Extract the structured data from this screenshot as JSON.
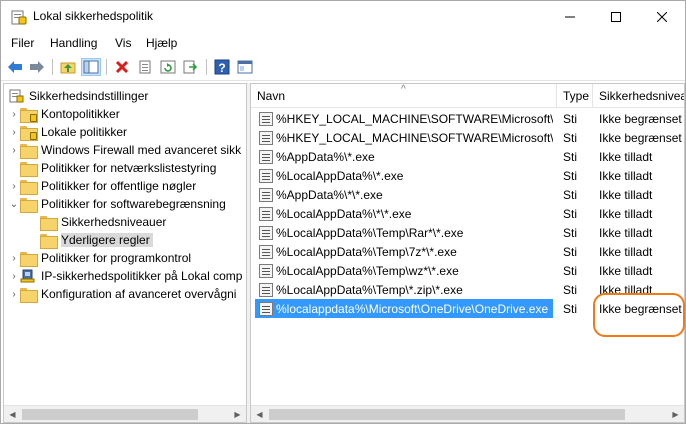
{
  "window": {
    "title": "Lokal sikkerhedspolitik",
    "icons": {
      "app": "security-policy-icon",
      "minimize": "minimize-icon",
      "maximize": "maximize-icon",
      "close": "close-icon"
    }
  },
  "menu": [
    "Filer",
    "Handling",
    "Vis",
    "Hjælp"
  ],
  "toolbar": [
    "back-icon",
    "forward-icon",
    "up-folder-icon",
    "show-hide-tree-icon",
    "delete-icon",
    "properties-icon",
    "refresh-icon",
    "export-list-icon",
    "help-icon",
    "console-tree-icon"
  ],
  "tree": {
    "root": "Sikkerhedsindstillinger",
    "items": [
      {
        "label": "Kontopolitikker",
        "expand": "›"
      },
      {
        "label": "Lokale politikker",
        "expand": "›"
      },
      {
        "label": "Windows Firewall med avanceret sikk",
        "expand": "›"
      },
      {
        "label": "Politikker for netværkslistestyring",
        "expand": ""
      },
      {
        "label": "Politikker for offentlige nøgler",
        "expand": "›"
      },
      {
        "label": "Politikker for softwarebegrænsning",
        "expand": "⌄"
      },
      {
        "label": "Sikkerhedsniveauer",
        "expand": ""
      },
      {
        "label": "Yderligere regler",
        "expand": ""
      },
      {
        "label": "Politikker for programkontrol",
        "expand": "›"
      },
      {
        "label": "IP-sikkerhedspolitikker på Lokal comp",
        "expand": "›"
      },
      {
        "label": "Konfiguration af avanceret overvågni",
        "expand": "›"
      }
    ]
  },
  "columns": {
    "name": "Navn",
    "type": "Type",
    "level": "Sikkerhedsnivea"
  },
  "rows": [
    {
      "name": "%HKEY_LOCAL_MACHINE\\SOFTWARE\\Microsoft\\...",
      "type": "Sti",
      "level": "Ikke begrænset"
    },
    {
      "name": "%HKEY_LOCAL_MACHINE\\SOFTWARE\\Microsoft\\...",
      "type": "Sti",
      "level": "Ikke begrænset"
    },
    {
      "name": "%AppData%\\*.exe",
      "type": "Sti",
      "level": "Ikke tilladt"
    },
    {
      "name": "%LocalAppData%\\*.exe",
      "type": "Sti",
      "level": "Ikke tilladt"
    },
    {
      "name": "%AppData%\\*\\*.exe",
      "type": "Sti",
      "level": "Ikke tilladt"
    },
    {
      "name": "%LocalAppData%\\*\\*.exe",
      "type": "Sti",
      "level": "Ikke tilladt"
    },
    {
      "name": "%LocalAppData%\\Temp\\Rar*\\*.exe",
      "type": "Sti",
      "level": "Ikke tilladt"
    },
    {
      "name": "%LocalAppData%\\Temp\\7z*\\*.exe",
      "type": "Sti",
      "level": "Ikke tilladt"
    },
    {
      "name": "%LocalAppData%\\Temp\\wz*\\*.exe",
      "type": "Sti",
      "level": "Ikke tilladt"
    },
    {
      "name": "%LocalAppData%\\Temp\\*.zip\\*.exe",
      "type": "Sti",
      "level": "Ikke tilladt"
    },
    {
      "name": "%localappdata%\\Microsoft\\OneDrive\\OneDrive.exe",
      "type": "Sti",
      "level": "Ikke begrænset"
    }
  ],
  "colors": {
    "selection": "#3399ff",
    "highlight_ring": "#f07a18"
  }
}
